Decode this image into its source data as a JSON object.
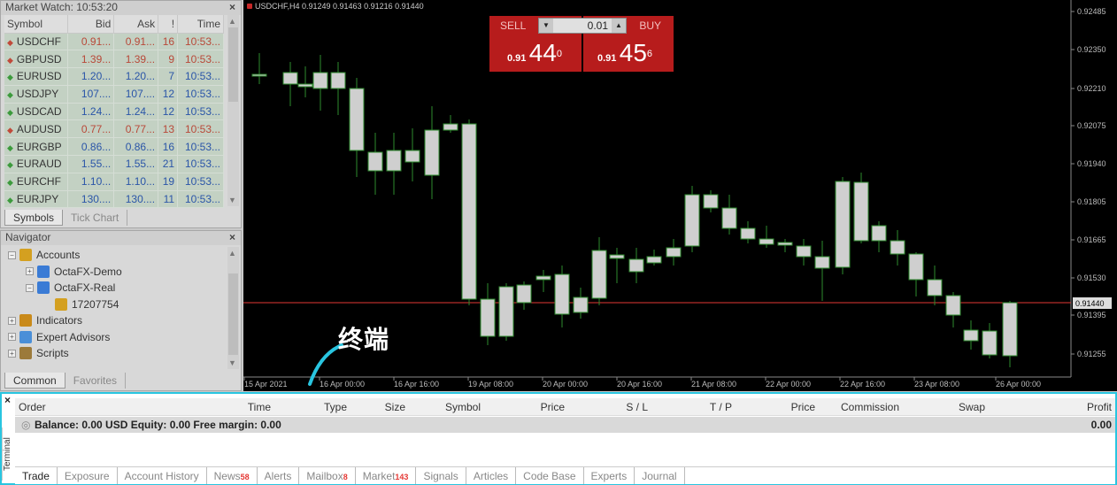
{
  "market_watch": {
    "title": "Market Watch: 10:53:20",
    "columns": [
      "Symbol",
      "Bid",
      "Ask",
      "!",
      "Time"
    ],
    "rows": [
      {
        "dir": "down",
        "symbol": "USDCHF",
        "bid": "0.91...",
        "ask": "0.91...",
        "spread": "16",
        "time": "10:53...",
        "color": "red"
      },
      {
        "dir": "down",
        "symbol": "GBPUSD",
        "bid": "1.39...",
        "ask": "1.39...",
        "spread": "9",
        "time": "10:53...",
        "color": "red"
      },
      {
        "dir": "up",
        "symbol": "EURUSD",
        "bid": "1.20...",
        "ask": "1.20...",
        "spread": "7",
        "time": "10:53...",
        "color": "blue"
      },
      {
        "dir": "up",
        "symbol": "USDJPY",
        "bid": "107....",
        "ask": "107....",
        "spread": "12",
        "time": "10:53...",
        "color": "blue"
      },
      {
        "dir": "up",
        "symbol": "USDCAD",
        "bid": "1.24...",
        "ask": "1.24...",
        "spread": "12",
        "time": "10:53...",
        "color": "blue"
      },
      {
        "dir": "down",
        "symbol": "AUDUSD",
        "bid": "0.77...",
        "ask": "0.77...",
        "spread": "13",
        "time": "10:53...",
        "color": "red"
      },
      {
        "dir": "up",
        "symbol": "EURGBP",
        "bid": "0.86...",
        "ask": "0.86...",
        "spread": "16",
        "time": "10:53...",
        "color": "blue"
      },
      {
        "dir": "up",
        "symbol": "EURAUD",
        "bid": "1.55...",
        "ask": "1.55...",
        "spread": "21",
        "time": "10:53...",
        "color": "blue"
      },
      {
        "dir": "up",
        "symbol": "EURCHF",
        "bid": "1.10...",
        "ask": "1.10...",
        "spread": "19",
        "time": "10:53...",
        "color": "blue"
      },
      {
        "dir": "up",
        "symbol": "EURJPY",
        "bid": "130....",
        "ask": "130....",
        "spread": "11",
        "time": "10:53...",
        "color": "blue"
      }
    ],
    "tabs": [
      "Symbols",
      "Tick Chart"
    ]
  },
  "navigator": {
    "title": "Navigator",
    "items": [
      {
        "label": "Accounts",
        "pm": "−",
        "depth": 0,
        "icon": "accounts-icon"
      },
      {
        "label": "OctaFX-Demo",
        "pm": "+",
        "depth": 1,
        "icon": "server-icon"
      },
      {
        "label": "OctaFX-Real",
        "pm": "−",
        "depth": 1,
        "icon": "server-icon"
      },
      {
        "label": "17207754",
        "pm": "",
        "depth": 2,
        "icon": "user-icon"
      },
      {
        "label": "Indicators",
        "pm": "+",
        "depth": 0,
        "icon": "indicators-icon"
      },
      {
        "label": "Expert Advisors",
        "pm": "+",
        "depth": 0,
        "icon": "expert-advisors-icon"
      },
      {
        "label": "Scripts",
        "pm": "+",
        "depth": 0,
        "icon": "scripts-icon"
      }
    ],
    "tabs": [
      "Common",
      "Favorites"
    ]
  },
  "chart": {
    "header": "USDCHF,H4  0.91249 0.91463 0.91216 0.91440",
    "price_labels": [
      "0.92485",
      "0.92350",
      "0.92210",
      "0.92075",
      "0.91940",
      "0.91805",
      "0.91665",
      "0.91530",
      "0.91395",
      "0.91255"
    ],
    "current_price": "0.91440",
    "time_labels": [
      "15 Apr 2021",
      "16 Apr 00:00",
      "16 Apr 16:00",
      "19 Apr 08:00",
      "20 Apr 00:00",
      "20 Apr 16:00",
      "21 Apr 08:00",
      "22 Apr 00:00",
      "22 Apr 16:00",
      "23 Apr 08:00",
      "26 Apr 00:00"
    ],
    "one_click": {
      "sell": "SELL",
      "buy": "BUY",
      "lot": "0.01",
      "sell_small": "0.91",
      "sell_big": "44",
      "sell_sup": "0",
      "buy_small": "0.91",
      "buy_big": "45",
      "buy_sup": "6"
    }
  },
  "annotation": "终端",
  "terminal": {
    "side_label": "Terminal",
    "columns": [
      "Order",
      "Time",
      "Type",
      "Size",
      "Symbol",
      "Price",
      "S / L",
      "T / P",
      "Price",
      "Commission",
      "Swap",
      "Profit"
    ],
    "balance_line": "Balance: 0.00 USD  Equity: 0.00  Free margin: 0.00",
    "profit": "0.00",
    "tabs": [
      {
        "label": "Trade",
        "badge": ""
      },
      {
        "label": "Exposure",
        "badge": ""
      },
      {
        "label": "Account History",
        "badge": ""
      },
      {
        "label": "News",
        "badge": "58"
      },
      {
        "label": "Alerts",
        "badge": ""
      },
      {
        "label": "Mailbox",
        "badge": "8"
      },
      {
        "label": "Market",
        "badge": "143"
      },
      {
        "label": "Signals",
        "badge": ""
      },
      {
        "label": "Articles",
        "badge": ""
      },
      {
        "label": "Code Base",
        "badge": ""
      },
      {
        "label": "Experts",
        "badge": ""
      },
      {
        "label": "Journal",
        "badge": ""
      }
    ]
  }
}
